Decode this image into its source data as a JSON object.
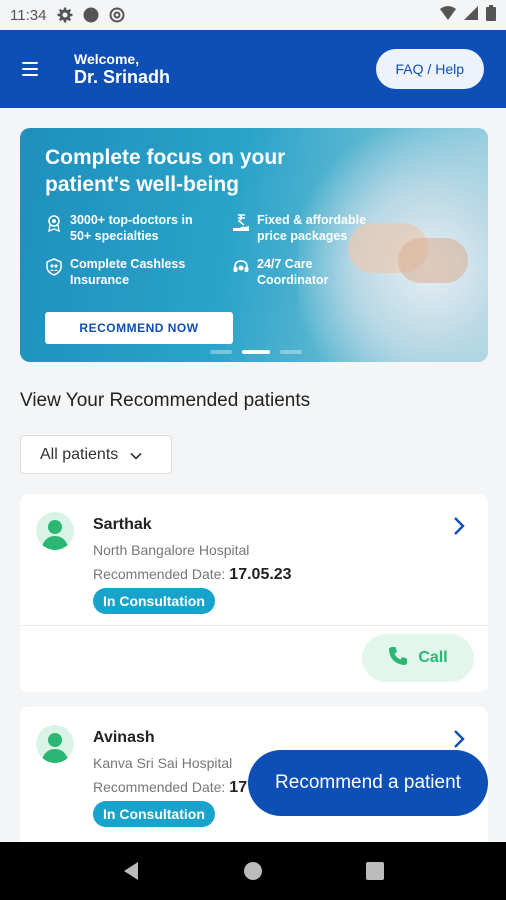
{
  "status_bar": {
    "time": "11:34"
  },
  "header": {
    "welcome": "Welcome,",
    "doctor_name": "Dr. Srinadh",
    "faq_label": "FAQ / Help"
  },
  "banner": {
    "title": "Complete focus on your patient's well-being",
    "features": [
      {
        "text": "3000+ top-doctors in 50+ specialties",
        "icon": "award-icon"
      },
      {
        "text": "Fixed & affordable price packages",
        "icon": "rupee-hand-icon"
      },
      {
        "text": "Complete Cashless Insurance",
        "icon": "family-shield-icon"
      },
      {
        "text": "24/7 Care Coordinator",
        "icon": "headset-icon"
      }
    ],
    "cta_label": "RECOMMEND NOW",
    "active_slide": 2,
    "slide_count": 3
  },
  "section": {
    "title": "View Your Recommended patients",
    "filter_label": "All patients"
  },
  "patients": [
    {
      "name": "Sarthak",
      "hospital": "North Bangalore Hospital",
      "date_label": "Recommended Date:",
      "date": "17.05.23",
      "status": "In Consultation",
      "call_label": "Call"
    },
    {
      "name": "Avinash",
      "hospital": "Kanva Sri Sai Hospital",
      "date_label": "Recommended Date:",
      "date": "17",
      "status": "In Consultation"
    }
  ],
  "fab_label": "Recommend a patient",
  "colors": {
    "primary": "#0d4fb4",
    "badge": "#17a3cc",
    "call_green": "#2bb673",
    "avatar_green": "#2bb673"
  }
}
